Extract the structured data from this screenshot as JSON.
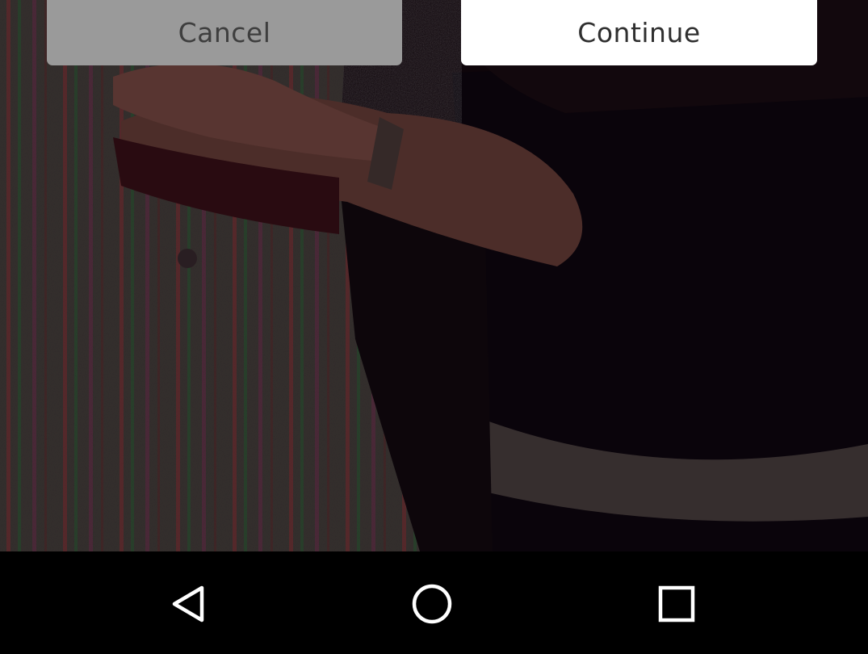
{
  "dialog": {
    "cancel_label": "Cancel",
    "continue_label": "Continue"
  },
  "navbar": {
    "back_icon": "back-triangle-icon",
    "home_icon": "home-circle-icon",
    "recents_icon": "recents-square-icon"
  },
  "colors": {
    "cancel_bg": "#9a9a9a",
    "continue_bg": "#ffffff",
    "navbar_bg": "#000000"
  }
}
